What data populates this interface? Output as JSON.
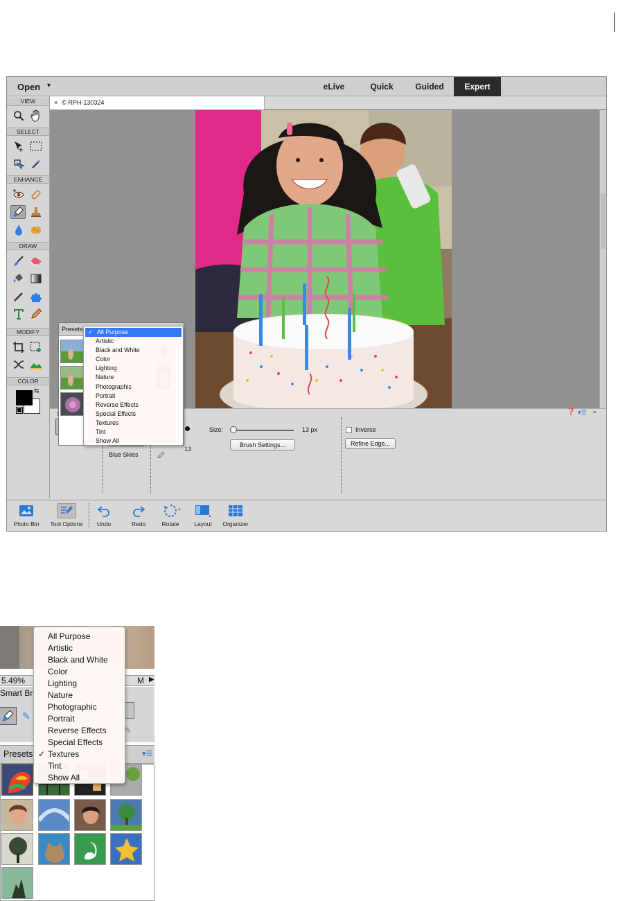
{
  "topbar": {
    "open_label": "Open",
    "modes": [
      "eLive",
      "Quick",
      "Guided",
      "Expert"
    ],
    "active_mode": "Expert"
  },
  "toolbox": {
    "sections": [
      "VIEW",
      "SELECT",
      "ENHANCE",
      "DRAW",
      "MODIFY",
      "COLOR"
    ]
  },
  "document": {
    "tab_close": "×",
    "tab_title": "© RPH-130324"
  },
  "presets_panel": {
    "header": "Presets"
  },
  "preset_menu_main": {
    "items": [
      "All Purpose",
      "Artistic",
      "Black and White",
      "Color",
      "Lighting",
      "Nature",
      "Photographic",
      "Portrait",
      "Reverse Effects",
      "Special Effects",
      "Textures",
      "Tint",
      "Show All"
    ],
    "checked": "All Purpose",
    "check_mark": "✓"
  },
  "tool_options": {
    "panel_initial": "S",
    "preset_name": "Blue Skies",
    "brush_number": "13",
    "size_label": "Size:",
    "size_value": "13 px",
    "brush_settings_label": "Brush Settings...",
    "inverse_label": "Inverse",
    "refine_edge_label": "Refine Edge...",
    "size_fraction": 0.05
  },
  "bottom_bar": {
    "buttons": [
      "Photo Bin",
      "Tool Options",
      "Undo",
      "Redo",
      "Rotate",
      "Layout",
      "Organizer"
    ]
  },
  "inset": {
    "zoom": "5.49%",
    "zoom_suffix": "M",
    "panel_label": "Smart Br",
    "presets_label": "Presets",
    "menu_items": [
      "All Purpose",
      "Artistic",
      "Black and White",
      "Color",
      "Lighting",
      "Nature",
      "Photographic",
      "Portrait",
      "Reverse Effects",
      "Special Effects",
      "Textures",
      "Tint",
      "Show All"
    ],
    "checked": "Textures",
    "check_mark": "✓"
  },
  "page_number": "1",
  "colors": {
    "accent": "#3478f6",
    "expert_tab": "#2b2b2b"
  }
}
